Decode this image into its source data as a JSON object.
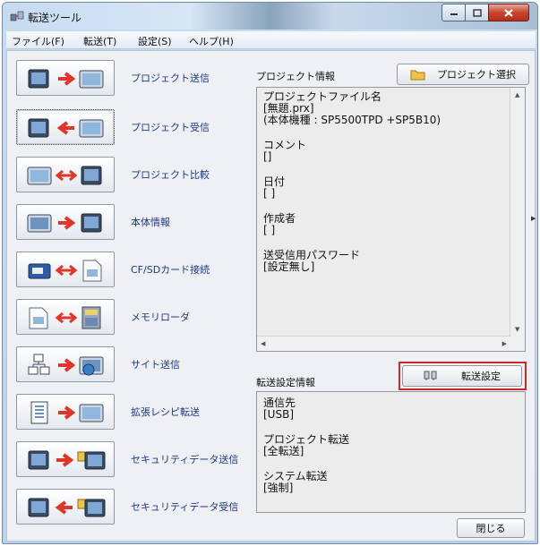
{
  "window": {
    "title": "転送ツール"
  },
  "menu": {
    "items": [
      "ファイル(F)",
      "転送(T)",
      "設定(S)",
      "ヘルプ(H)"
    ]
  },
  "tools": [
    {
      "label": "プロジェクト送信"
    },
    {
      "label": "プロジェクト受信"
    },
    {
      "label": "プロジェクト比較"
    },
    {
      "label": "本体情報"
    },
    {
      "label": "CF/SDカード接続"
    },
    {
      "label": "メモリローダ"
    },
    {
      "label": "サイト送信"
    },
    {
      "label": "拡張レシピ転送"
    },
    {
      "label": "セキュリティデータ送信"
    },
    {
      "label": "セキュリティデータ受信"
    }
  ],
  "project_info": {
    "label": "プロジェクト情報",
    "select_button": "プロジェクト選択",
    "lines": [
      "プロジェクトファイル名",
      "[無題.prx]",
      "(本体機種 : SP5500TPD +SP5B10)",
      "コメント",
      "[]",
      "日付",
      "[                              ]",
      "作成者",
      "[              ]",
      "送受信用パスワード",
      "[設定無し]"
    ]
  },
  "transfer_info": {
    "label": "転送設定情報",
    "settings_button": "転送設定",
    "lines": [
      "通信先",
      "[USB]",
      "プロジェクト転送",
      "[全転送]",
      "システム転送",
      "[強制]"
    ]
  },
  "footer": {
    "close_button": "閉じる"
  },
  "colors": {
    "accent_red": "#cc2a2a",
    "link_blue": "#1d3a8a",
    "arrow_red": "#e0362a"
  }
}
